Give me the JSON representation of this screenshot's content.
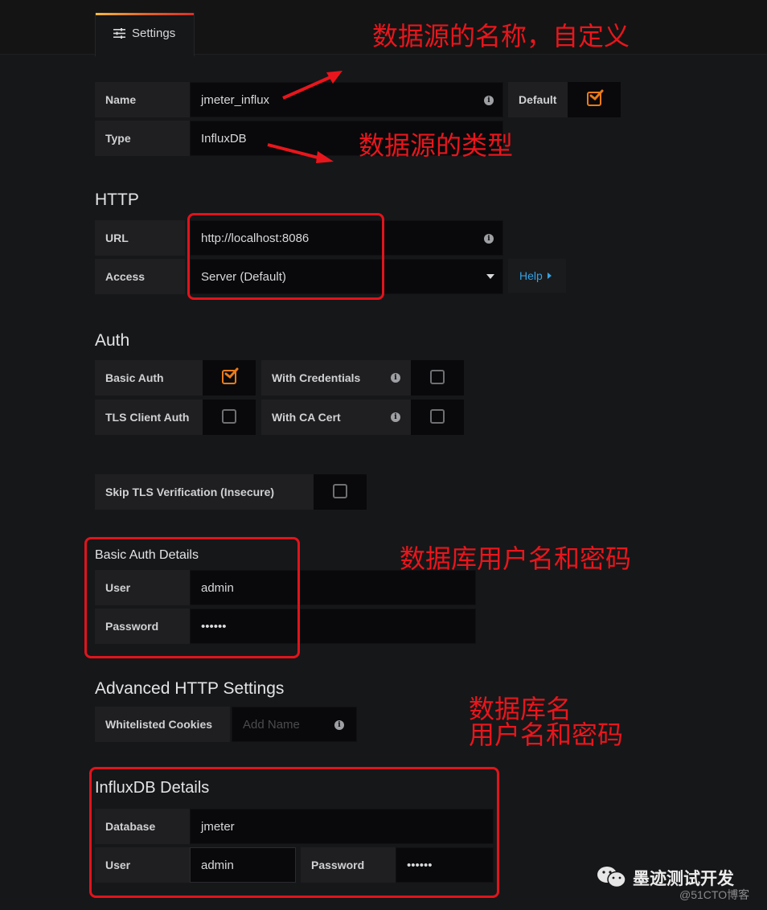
{
  "tab": {
    "label": "Settings",
    "icon": "sliders-icon"
  },
  "general": {
    "name_label": "Name",
    "name_value": "jmeter_influx",
    "default_label": "Default",
    "default_checked": true,
    "type_label": "Type",
    "type_value": "InfluxDB"
  },
  "http": {
    "title": "HTTP",
    "url_label": "URL",
    "url_value": "http://localhost:8086",
    "access_label": "Access",
    "access_value": "Server (Default)",
    "help_label": "Help"
  },
  "auth": {
    "title": "Auth",
    "basic_auth_label": "Basic Auth",
    "basic_auth_checked": true,
    "with_credentials_label": "With Credentials",
    "with_credentials_checked": false,
    "tls_client_auth_label": "TLS Client Auth",
    "tls_client_auth_checked": false,
    "with_ca_cert_label": "With CA Cert",
    "with_ca_cert_checked": false,
    "skip_tls_label": "Skip TLS Verification (Insecure)",
    "skip_tls_checked": false
  },
  "basic_auth_details": {
    "title": "Basic Auth Details",
    "user_label": "User",
    "user_value": "admin",
    "password_label": "Password",
    "password_value": "••••••"
  },
  "advanced_http": {
    "title": "Advanced HTTP Settings",
    "cookies_label": "Whitelisted Cookies",
    "cookies_placeholder": "Add Name"
  },
  "influxdb_details": {
    "title": "InfluxDB Details",
    "database_label": "Database",
    "database_value": "jmeter",
    "user_label": "User",
    "user_value": "admin",
    "password_label": "Password",
    "password_value": "••••••"
  },
  "annotations": {
    "name_note": "数据源的名称，自定义",
    "type_note": "数据源的类型",
    "basic_auth_note": "数据库用户名和密码",
    "influx_note": "数据库名\n用户名和密码",
    "color": "#e8161c"
  },
  "watermark": {
    "title": "墨迹测试开发",
    "subtitle": "@51CTO博客"
  },
  "colors": {
    "accent_orange": "#eb7b18",
    "link_blue": "#33a2e5",
    "background": "#161719"
  }
}
